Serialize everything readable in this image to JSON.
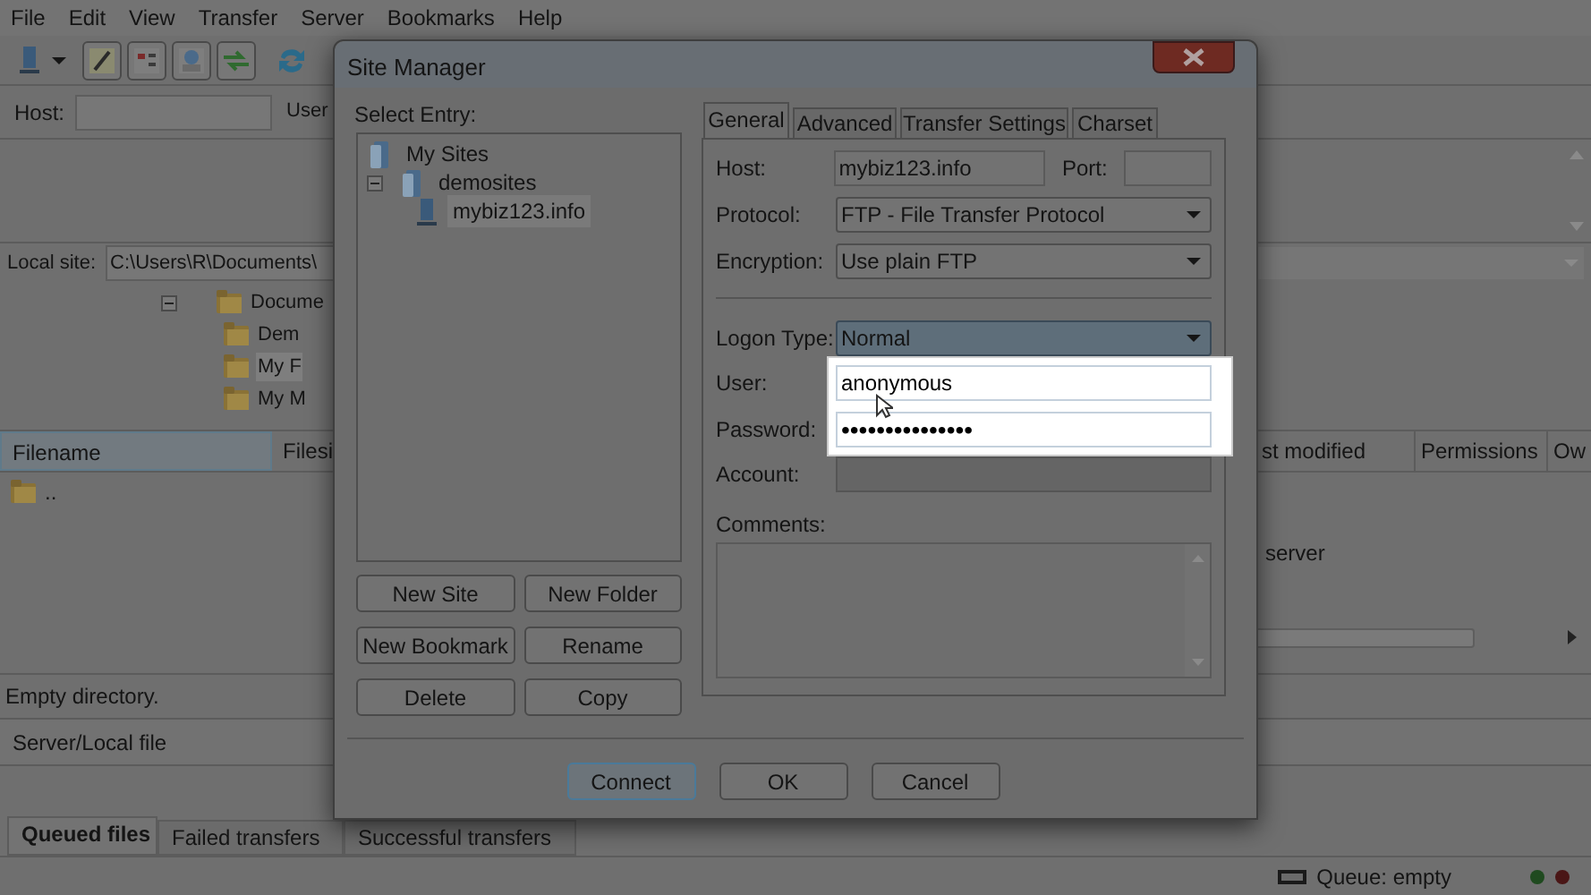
{
  "menu": [
    "File",
    "Edit",
    "View",
    "Transfer",
    "Server",
    "Bookmarks",
    "Help"
  ],
  "quickconnect": {
    "host_label": "Host:",
    "user_label": "User"
  },
  "local_site": {
    "label": "Local site:",
    "path": "C:\\Users\\R\\Documents\\"
  },
  "local_tree": {
    "label": "Docume",
    "expanded": true,
    "children": [
      {
        "label": "Dem",
        "selected": false
      },
      {
        "label": "My F",
        "selected": true
      },
      {
        "label": "My M",
        "selected": false
      }
    ]
  },
  "local_files": {
    "columns": [
      "Filename",
      "Filesi"
    ],
    "rows": [
      ".."
    ],
    "status": "Empty directory."
  },
  "remote_files": {
    "columns": [
      "st modified",
      "Permissions",
      "Ow"
    ],
    "message": "server"
  },
  "queue": {
    "columns": [
      "Server/Local file"
    ],
    "tabs": [
      {
        "label": "Queued files",
        "selected": true
      },
      {
        "label": "Failed transfers",
        "selected": false
      },
      {
        "label": "Successful transfers",
        "selected": false
      }
    ]
  },
  "status_bar": {
    "queue": "Queue: empty"
  },
  "dialog": {
    "title": "Site Manager",
    "select_entry_label": "Select Entry:",
    "tree": [
      {
        "label": "My Sites",
        "kind": "root",
        "selected": false,
        "children": [
          {
            "label": "demosites",
            "kind": "folder",
            "selected": false,
            "expanded": true,
            "children": [
              {
                "label": "mybiz123.info",
                "kind": "server",
                "selected": true
              }
            ]
          }
        ]
      }
    ],
    "entry_buttons": [
      "New Site",
      "New Folder",
      "New Bookmark",
      "Rename",
      "Delete",
      "Copy"
    ],
    "tabs": [
      {
        "label": "General",
        "selected": true
      },
      {
        "label": "Advanced",
        "selected": false
      },
      {
        "label": "Transfer Settings",
        "selected": false
      },
      {
        "label": "Charset",
        "selected": false
      }
    ],
    "host": {
      "label": "Host:",
      "value": "mybiz123.info"
    },
    "port": {
      "label": "Port:"
    },
    "protocol": {
      "label": "Protocol:",
      "value": "FTP - File Transfer Protocol"
    },
    "encryption": {
      "label": "Encryption:",
      "value": "Use plain FTP"
    },
    "logon_type": {
      "label": "Logon Type:",
      "value": "Normal",
      "focused": true
    },
    "user": {
      "label": "User:",
      "value": "anonymous",
      "highlighted": true
    },
    "password": {
      "label": "Password:",
      "value": "•••••••••••••••",
      "highlighted": true
    },
    "account": {
      "label": "Account:",
      "disabled": true
    },
    "comments": {
      "label": "Comments:"
    },
    "buttons": [
      {
        "label": "Connect",
        "default": true
      },
      {
        "label": "OK",
        "default": false
      },
      {
        "label": "Cancel",
        "default": false
      }
    ]
  }
}
